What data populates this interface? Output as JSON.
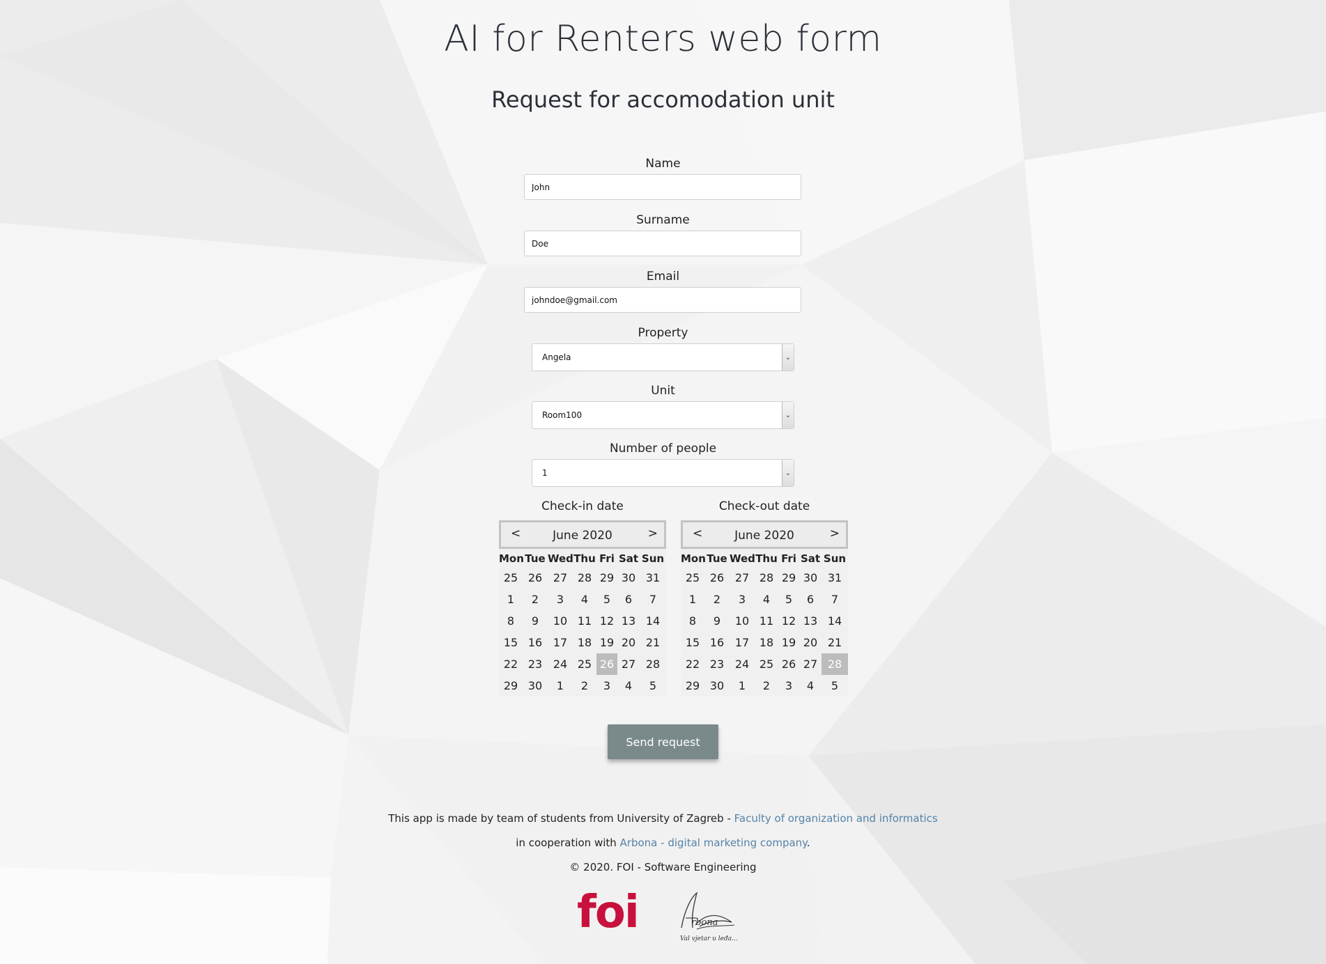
{
  "header": {
    "title": "AI for Renters web form",
    "subtitle": "Request for accomodation unit"
  },
  "form": {
    "name": {
      "label": "Name",
      "value": "John"
    },
    "surname": {
      "label": "Surname",
      "value": "Doe"
    },
    "email": {
      "label": "Email",
      "value": "johndoe@gmail.com"
    },
    "property": {
      "label": "Property",
      "value": "Angela"
    },
    "unit": {
      "label": "Unit",
      "value": "Room100"
    },
    "people": {
      "label": "Number of people",
      "value": "1"
    },
    "submit_label": "Send request"
  },
  "calendars": {
    "checkin": {
      "label": "Check-in date",
      "month": "June 2020",
      "prev": "<",
      "next": ">",
      "weekdays": [
        "Mon",
        "Tue",
        "Wed",
        "Thu",
        "Fri",
        "Sat",
        "Sun"
      ],
      "weeks": [
        [
          "25",
          "26",
          "27",
          "28",
          "29",
          "30",
          "31"
        ],
        [
          "1",
          "2",
          "3",
          "4",
          "5",
          "6",
          "7"
        ],
        [
          "8",
          "9",
          "10",
          "11",
          "12",
          "13",
          "14"
        ],
        [
          "15",
          "16",
          "17",
          "18",
          "19",
          "20",
          "21"
        ],
        [
          "22",
          "23",
          "24",
          "25",
          "26",
          "27",
          "28"
        ],
        [
          "29",
          "30",
          "1",
          "2",
          "3",
          "4",
          "5"
        ]
      ],
      "selected": "26"
    },
    "checkout": {
      "label": "Check-out date",
      "month": "June 2020",
      "prev": "<",
      "next": ">",
      "weekdays": [
        "Mon",
        "Tue",
        "Wed",
        "Thu",
        "Fri",
        "Sat",
        "Sun"
      ],
      "weeks": [
        [
          "25",
          "26",
          "27",
          "28",
          "29",
          "30",
          "31"
        ],
        [
          "1",
          "2",
          "3",
          "4",
          "5",
          "6",
          "7"
        ],
        [
          "8",
          "9",
          "10",
          "11",
          "12",
          "13",
          "14"
        ],
        [
          "15",
          "16",
          "17",
          "18",
          "19",
          "20",
          "21"
        ],
        [
          "22",
          "23",
          "24",
          "25",
          "26",
          "27",
          "28"
        ],
        [
          "29",
          "30",
          "1",
          "2",
          "3",
          "4",
          "5"
        ]
      ],
      "selected": "28"
    }
  },
  "footer": {
    "line1_text": "This app is made by team of students from University of Zagreb - ",
    "line1_link": "Faculty of organization and informatics",
    "line2_text": "in cooperation with ",
    "line2_link": "Arbona - digital marketing company",
    "line2_end": ".",
    "copyright": "© 2020. FOI - Software Engineering"
  },
  "logos": {
    "foi": "foi",
    "arbona_tagline": "Val vjetar u leđa..."
  },
  "colors": {
    "button": "#7a8a8a",
    "link": "#5583a8",
    "foi_brand": "#c8103c",
    "selected_day": "#bcbcbc"
  }
}
